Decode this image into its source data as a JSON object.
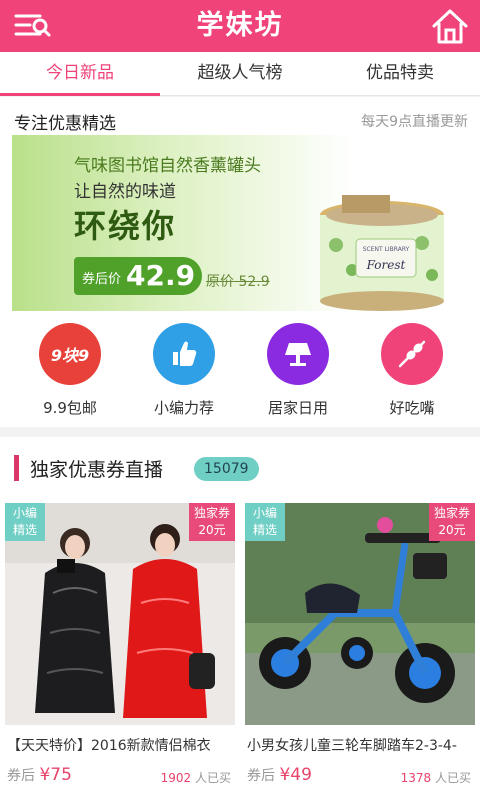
{
  "header": {
    "title": "学妹坊"
  },
  "tabs": [
    {
      "label": "今日新品",
      "active": true
    },
    {
      "label": "超级人气榜",
      "active": false
    },
    {
      "label": "优品特卖",
      "active": false
    }
  ],
  "featured": {
    "heading": "专注优惠精选",
    "note": "每天9点直播更新",
    "banner": {
      "line1": "气味图书馆自然香薰罐头",
      "line2": "让自然的味道",
      "line3": "环绕你",
      "price_label": "券后价",
      "price": "42.9",
      "original": "原价 52.9",
      "can_brand": "SCENT LIBRARY",
      "can_name": "Forest"
    }
  },
  "categories": [
    {
      "label": "9.9包邮",
      "badge": "9块9",
      "color": "#e8413a"
    },
    {
      "label": "小编力荐",
      "color": "#2f9fe6"
    },
    {
      "label": "居家日用",
      "color": "#8a2be2"
    },
    {
      "label": "好吃嘴",
      "color": "#f0437a"
    }
  ],
  "coupons": {
    "title": "独家优惠券直播",
    "count": "15079"
  },
  "products": [
    {
      "tag_left": [
        "小编",
        "精选"
      ],
      "tag_right": [
        "独家券",
        "20元"
      ],
      "name": "【天天特价】2016新款情侣棉衣",
      "price_label": "券后",
      "price": "¥75",
      "sold_count": "1902",
      "sold_label": "人已买"
    },
    {
      "tag_left": [
        "小编",
        "精选"
      ],
      "tag_right": [
        "独家券",
        "20元"
      ],
      "name": "小男女孩儿童三轮车脚踏车2-3-4-",
      "price_label": "券后",
      "price": "¥49",
      "sold_count": "1378",
      "sold_label": "人已买"
    }
  ],
  "colors": {
    "brand": "#f0437a",
    "accent_green": "#4fa12a",
    "teal": "#6fcfc4"
  }
}
